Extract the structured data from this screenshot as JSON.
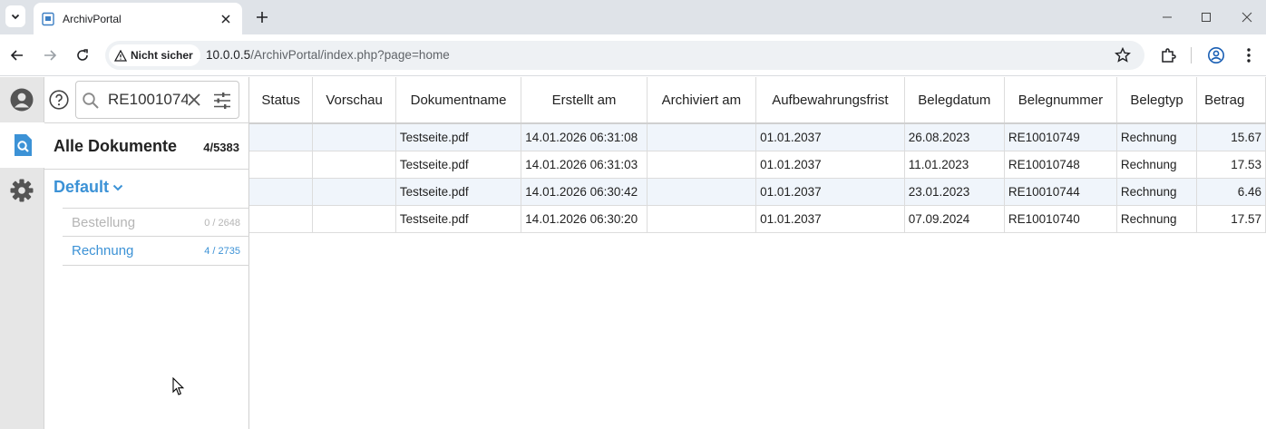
{
  "browser": {
    "tab_title": "ArchivPortal",
    "security_label": "Nicht sicher",
    "url_host": "10.0.0.5",
    "url_path": "/ArchivPortal/index.php?page=home"
  },
  "sidebar": {
    "search_value": "RE1001074",
    "all_docs_label": "Alle Dokumente",
    "all_docs_count": "4/5383",
    "group_label": "Default",
    "doctypes": [
      {
        "label": "Bestellung",
        "count": "0 / 2648",
        "state": "disabled"
      },
      {
        "label": "Rechnung",
        "count": "4 / 2735",
        "state": "active"
      }
    ]
  },
  "table": {
    "columns": [
      "Status",
      "Vorschau",
      "Dokumentname",
      "Erstellt am",
      "Archiviert am",
      "Aufbewahrungsfrist",
      "Belegdatum",
      "Belegnummer",
      "Belegtyp",
      "Betrag"
    ],
    "rows": [
      [
        "",
        "",
        "Testseite.pdf",
        "14.01.2026 06:31:08",
        "",
        "01.01.2037",
        "26.08.2023",
        "RE10010749",
        "Rechnung",
        "15.67"
      ],
      [
        "",
        "",
        "Testseite.pdf",
        "14.01.2026 06:31:03",
        "",
        "01.01.2037",
        "11.01.2023",
        "RE10010748",
        "Rechnung",
        "17.53"
      ],
      [
        "",
        "",
        "Testseite.pdf",
        "14.01.2026 06:30:42",
        "",
        "01.01.2037",
        "23.01.2023",
        "RE10010744",
        "Rechnung",
        "6.46"
      ],
      [
        "",
        "",
        "Testseite.pdf",
        "14.01.2026 06:30:20",
        "",
        "01.01.2037",
        "07.09.2024",
        "RE10010740",
        "Rechnung",
        "17.57"
      ]
    ]
  },
  "colors": {
    "accent": "#3c92d6",
    "row_alt": "#f0f5fb",
    "rail_bg": "#e6e6e6"
  },
  "icons": {
    "rail": [
      "user-icon",
      "document-search-icon",
      "settings-gear-icon"
    ]
  }
}
